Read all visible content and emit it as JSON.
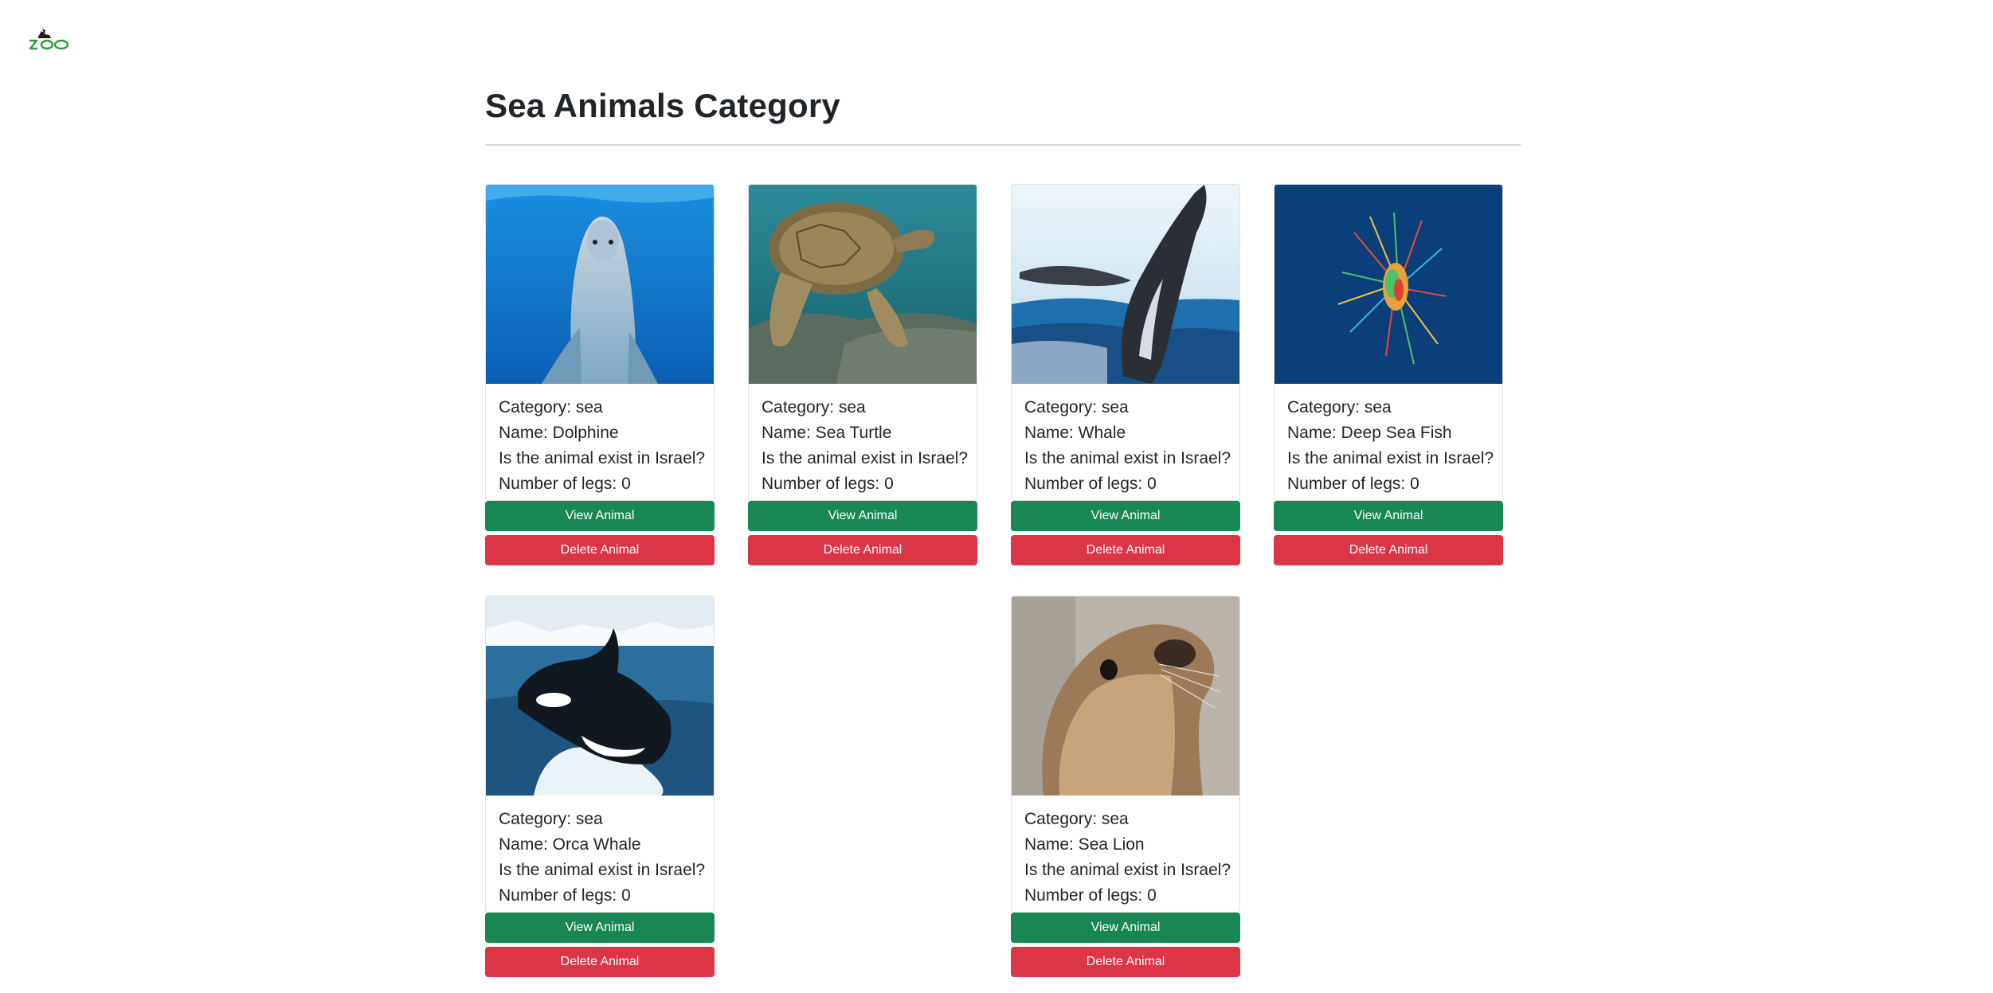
{
  "app": {
    "logo_text": "zoo"
  },
  "header": {
    "title": "Sea Animals Category"
  },
  "labels": {
    "category_prefix": "Category: ",
    "name_prefix": "Name: ",
    "israel_question": "Is the animal exist in Israel?",
    "legs_prefix": "Number of legs: ",
    "view_button": "View Animal",
    "delete_button": "Delete Animal"
  },
  "animals": [
    {
      "category": "Category: sea",
      "name": "Name: Dolphine",
      "israel": "Is the animal exist in Israel?",
      "legs": "Number of legs: 0",
      "view": "View Animal",
      "delete": "Delete Animal",
      "image": "dolphin-photo"
    },
    {
      "category": "Category: sea",
      "name": "Name: Sea Turtle",
      "israel": "Is the animal exist in Israel?",
      "legs": "Number of legs: 0",
      "view": "View Animal",
      "delete": "Delete Animal",
      "image": "sea-turtle-photo"
    },
    {
      "category": "Category: sea",
      "name": "Name: Whale",
      "israel": "Is the animal exist in Israel?",
      "legs": "Number of legs: 0",
      "view": "View Animal",
      "delete": "Delete Animal",
      "image": "whale-photo"
    },
    {
      "category": "Category: sea",
      "name": "Name: Deep Sea Fish",
      "israel": "Is the animal exist in Israel?",
      "legs": "Number of legs: 0",
      "view": "View Animal",
      "delete": "Delete Animal",
      "image": "deep-sea-fish-photo"
    },
    {
      "category": "Category: sea",
      "name": "Name: Orca Whale",
      "israel": "Is the animal exist in Israel?",
      "legs": "Number of legs: 0",
      "view": "View Animal",
      "delete": "Delete Animal",
      "image": "orca-photo"
    },
    {
      "category": "Category: sea",
      "name": "Name: Sea Lion",
      "israel": "Is the animal exist in Israel?",
      "legs": "Number of legs: 0",
      "view": "View Animal",
      "delete": "Delete Animal",
      "image": "sea-lion-photo"
    }
  ],
  "colors": {
    "view_button": "#198754",
    "delete_button": "#dc3545",
    "logo_green": "#2e9e3a",
    "text": "#212529"
  }
}
